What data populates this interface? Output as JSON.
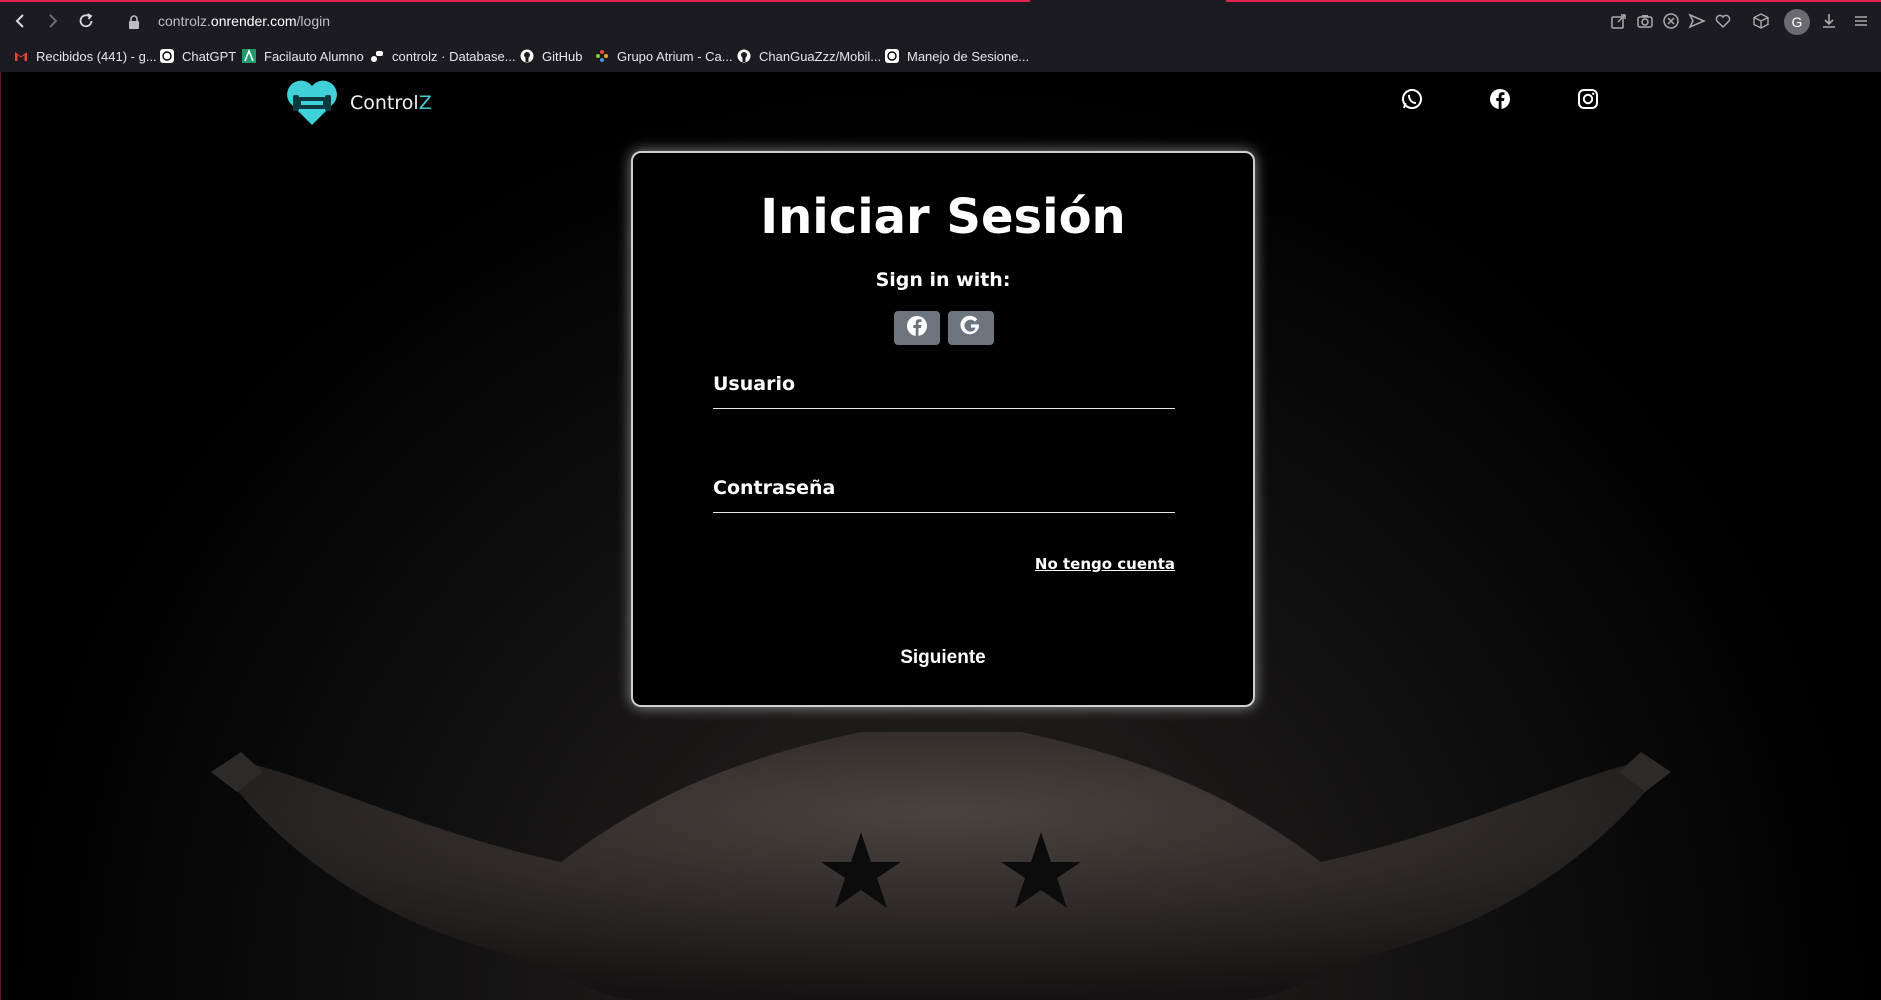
{
  "browser": {
    "url_prefix": "controlz.",
    "url_host": "onrender.com",
    "url_path": "/login",
    "profile_initial": "G",
    "bookmarks": [
      {
        "label": "Recibidos (441) - g...",
        "icon": "gmail-icon"
      },
      {
        "label": "ChatGPT",
        "icon": "chatgpt-icon"
      },
      {
        "label": "Facilauto Alumno",
        "icon": "facilauto-icon"
      },
      {
        "label": "controlz · Database...",
        "icon": "render-icon"
      },
      {
        "label": "GitHub",
        "icon": "github-icon"
      },
      {
        "label": "Grupo Atrium - Ca...",
        "icon": "atrium-icon"
      },
      {
        "label": "ChanGuaZzz/Mobil...",
        "icon": "github-icon"
      },
      {
        "label": "Manejo de Sesione...",
        "icon": "chatgpt-icon"
      }
    ]
  },
  "header": {
    "brand_main": "Control",
    "brand_accent": "Z"
  },
  "login": {
    "title": "Iniciar Sesión",
    "sign_in_with": "Sign in with:",
    "username_label": "Usuario",
    "password_label": "Contraseña",
    "no_account_link": "No tengo cuenta",
    "submit_label": "Siguiente"
  },
  "colors": {
    "accent": "#3fd0d8",
    "chrome_accent": "#e0244f",
    "social_button": "#6c757d"
  }
}
